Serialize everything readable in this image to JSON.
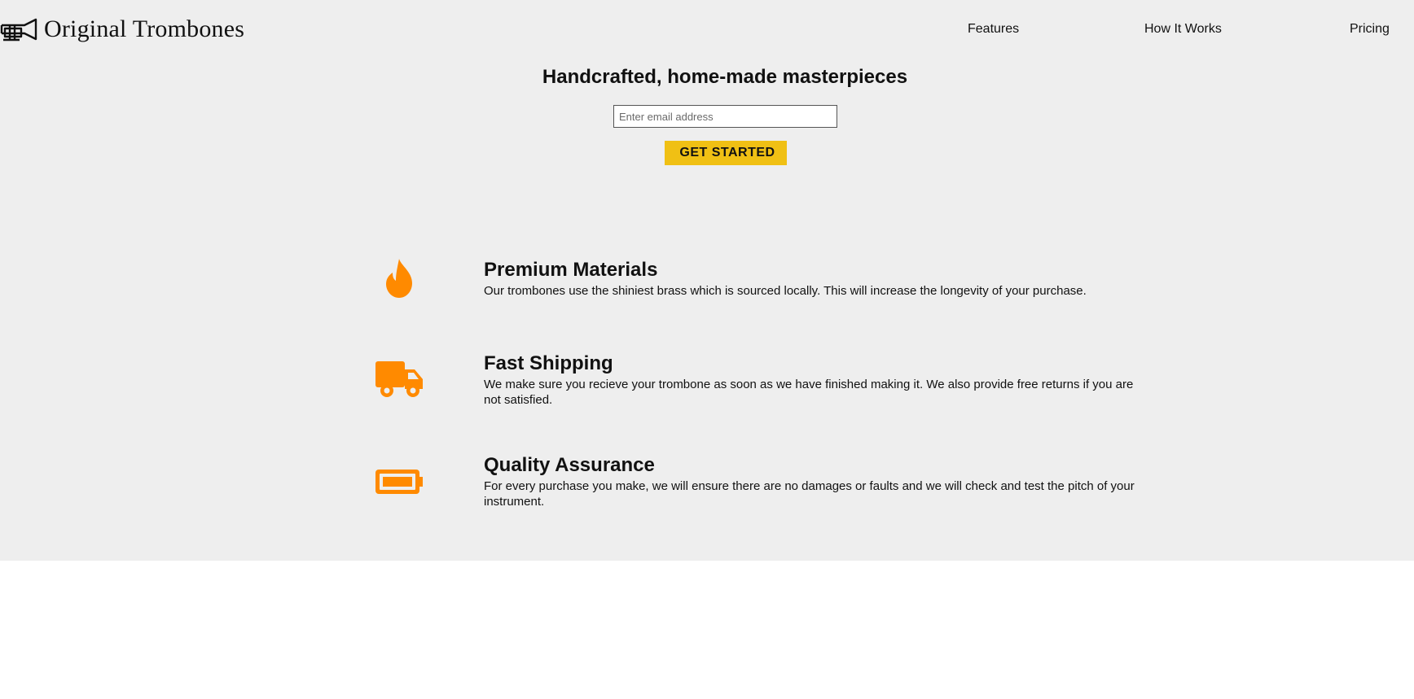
{
  "brand": {
    "name": "Original Trombones",
    "icon": "trombone-icon"
  },
  "nav": {
    "items": [
      {
        "label": "Features"
      },
      {
        "label": "How It Works"
      },
      {
        "label": "Pricing"
      }
    ]
  },
  "hero": {
    "title": "Handcrafted, home-made masterpieces",
    "email_placeholder": "Enter email address",
    "email_value": "",
    "cta_label": "GET STARTED"
  },
  "features": [
    {
      "icon": "fire-icon",
      "title": "Premium Materials",
      "description": "Our trombones use the shiniest brass which is sourced locally. This will increase the longevity of your purchase."
    },
    {
      "icon": "truck-icon",
      "title": "Fast Shipping",
      "description": "We make sure you recieve your trombone as soon as we have finished making it. We also provide free returns if you are not satisfied."
    },
    {
      "icon": "battery-icon",
      "title": "Quality Assurance",
      "description": "For every purchase you make, we will ensure there are no damages or faults and we will check and test the pitch of your instrument."
    }
  ],
  "colors": {
    "background": "#eeeeee",
    "accent_icon": "#ff8a00",
    "cta": "#f0c014",
    "text": "#111111"
  }
}
